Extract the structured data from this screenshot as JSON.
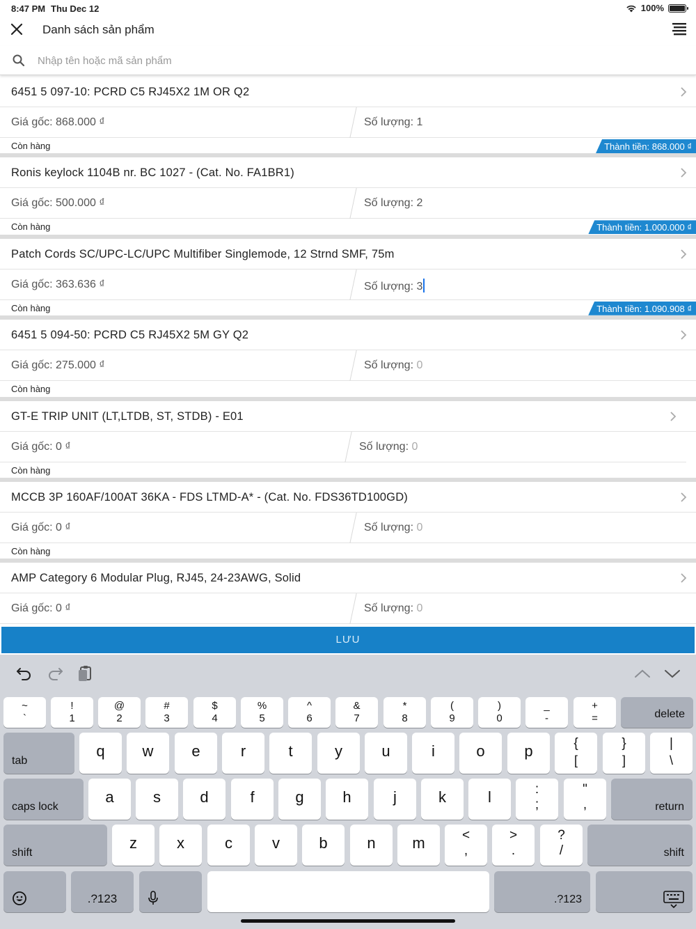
{
  "status": {
    "time": "8:47 PM",
    "date": "Thu Dec 12",
    "battery": "100%"
  },
  "header": {
    "title": "Danh sách sản phẩm"
  },
  "search": {
    "placeholder": "Nhập tên hoặc mã sản phẩm"
  },
  "products": [
    {
      "name": "6451 5 097-10: PCRD C5 RJ45X2 1M OR Q2",
      "price_label": "Giá gốc: 868.000 ₫",
      "qty_label": "Số lượng: ",
      "qty_value": "1",
      "stock": "Còn hàng",
      "total": "Thành tiền: 868.000 ₫"
    },
    {
      "name": "Ronis keylock 1104B nr. BC 1027 - (Cat. No. FA1BR1)",
      "price_label": "Giá gốc: 500.000 ₫",
      "qty_label": "Số lượng: ",
      "qty_value": "2",
      "stock": "Còn hàng",
      "total": "Thành tiền: 1.000.000 ₫"
    },
    {
      "name": "Patch Cords SC/UPC-LC/UPC Multifiber Singlemode, 12 Strnd SMF, 75m",
      "price_label": "Giá gốc: 363.636 ₫",
      "qty_label": "Số lượng: ",
      "qty_value": "3",
      "stock": "Còn hàng",
      "total": "Thành tiền: 1.090.908 ₫"
    },
    {
      "name": "6451 5 094-50: PCRD C5 RJ45X2 5M GY Q2",
      "price_label": "Giá gốc: 275.000 ₫",
      "qty_label": "Số lượng: ",
      "qty_value": "0",
      "stock": "Còn hàng",
      "total": ""
    },
    {
      "name": "GT-E TRIP UNIT (LT,LTDB, ST, STDB) - E01",
      "price_label": "Giá gốc: 0 ₫",
      "qty_label": "Số lượng: ",
      "qty_value": "0",
      "stock": "Còn hàng",
      "total": ""
    },
    {
      "name": "MCCB 3P 160AF/100AT 36KA - FDS LTMD-A* - (Cat. No. FDS36TD100GD)",
      "price_label": "Giá gốc: 0 ₫",
      "qty_label": "Số lượng: ",
      "qty_value": "0",
      "stock": "Còn hàng",
      "total": ""
    },
    {
      "name": "AMP Category 6 Modular Plug, RJ45, 24-23AWG, Solid",
      "price_label": "Giá gốc: 0 ₫",
      "qty_label": "Số lượng: ",
      "qty_value": "0",
      "stock": "",
      "total": ""
    }
  ],
  "save_label": "LƯU",
  "keyboard": {
    "row1": [
      [
        "~",
        "`"
      ],
      [
        "!",
        "1"
      ],
      [
        "@",
        "2"
      ],
      [
        "#",
        "3"
      ],
      [
        "$",
        "4"
      ],
      [
        "%",
        "5"
      ],
      [
        "^",
        "6"
      ],
      [
        "&",
        "7"
      ],
      [
        "*",
        "8"
      ],
      [
        "(",
        "9"
      ],
      [
        ")",
        "0"
      ],
      [
        "_",
        "-"
      ],
      [
        "+",
        "="
      ]
    ],
    "delete": "delete",
    "tab": "tab",
    "row2": [
      "q",
      "w",
      "e",
      "r",
      "t",
      "y",
      "u",
      "i",
      "o",
      "p"
    ],
    "row2_sym": [
      [
        "{",
        "["
      ],
      [
        "}",
        "]"
      ],
      [
        "|",
        "\\"
      ]
    ],
    "caps_lock": "caps lock",
    "row3": [
      "a",
      "s",
      "d",
      "f",
      "g",
      "h",
      "j",
      "k",
      "l"
    ],
    "row3_sym": [
      [
        ":",
        ";"
      ],
      [
        "\"",
        ","
      ]
    ],
    "return": "return",
    "shift": "shift",
    "row4": [
      "z",
      "x",
      "c",
      "v",
      "b",
      "n",
      "m"
    ],
    "row4_sym": [
      [
        "<",
        ","
      ],
      [
        ">",
        "."
      ],
      [
        "?",
        "/"
      ]
    ],
    "numbers": ".?123"
  },
  "colors": {
    "accent": "#1e88d0",
    "save": "#1781c8",
    "keyboard_bg": "#d2d5db",
    "caret": "#1a73e8"
  }
}
